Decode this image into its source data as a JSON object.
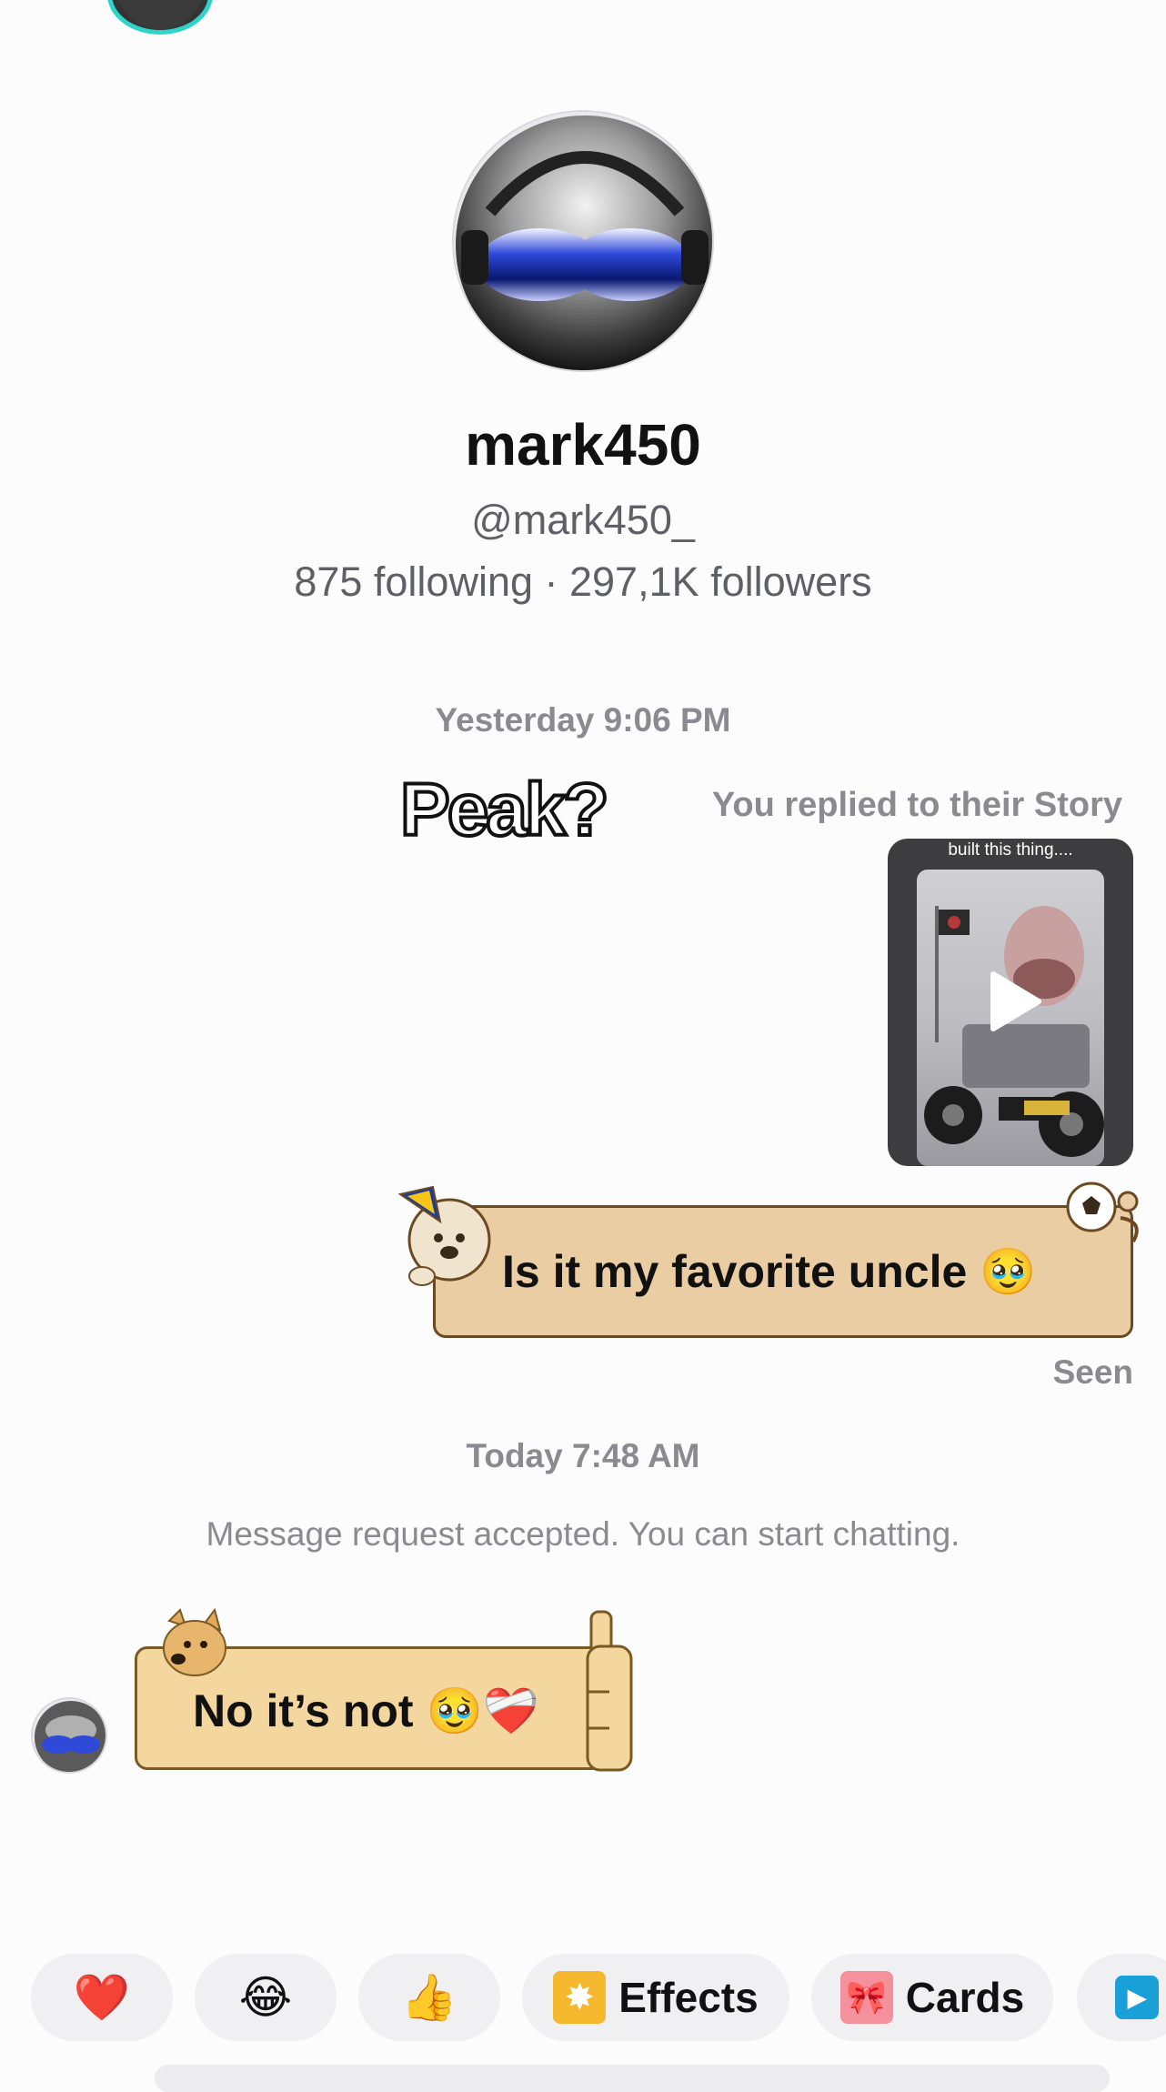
{
  "profile": {
    "display_name": "mark450",
    "username": "@mark450_",
    "stats": "875 following · 297,1K followers"
  },
  "messages": {
    "timestamp_yesterday": "Yesterday 9:06 PM",
    "story_reply": {
      "sticker_text": "Peak?",
      "label": "You replied to their Story",
      "story_caption": "built this thing...."
    },
    "outgoing_text": "Is it my favorite uncle 🥹",
    "seen_label": "Seen",
    "timestamp_today": "Today 7:48 AM",
    "request_note": "Message request accepted. You can start chatting.",
    "incoming_text": "No it’s not 🥹❤️‍🩹"
  },
  "reactions": [
    {
      "emoji": "❤️",
      "icon": "heart-icon"
    },
    {
      "emoji": "😂",
      "icon": "laughing-face-icon"
    },
    {
      "emoji": "👍",
      "icon": "thumbs-up-icon"
    }
  ],
  "quick_actions": {
    "effects_label": "Effects",
    "cards_label": "Cards"
  },
  "colors": {
    "accent_ring": "#2fd3c7",
    "outgoing_bubble": "#eacda3",
    "incoming_bubble": "#f3d79e",
    "effects_badge": "#f5b82e",
    "cards_badge": "#f4919d",
    "more_badge": "#1aa0d8"
  }
}
